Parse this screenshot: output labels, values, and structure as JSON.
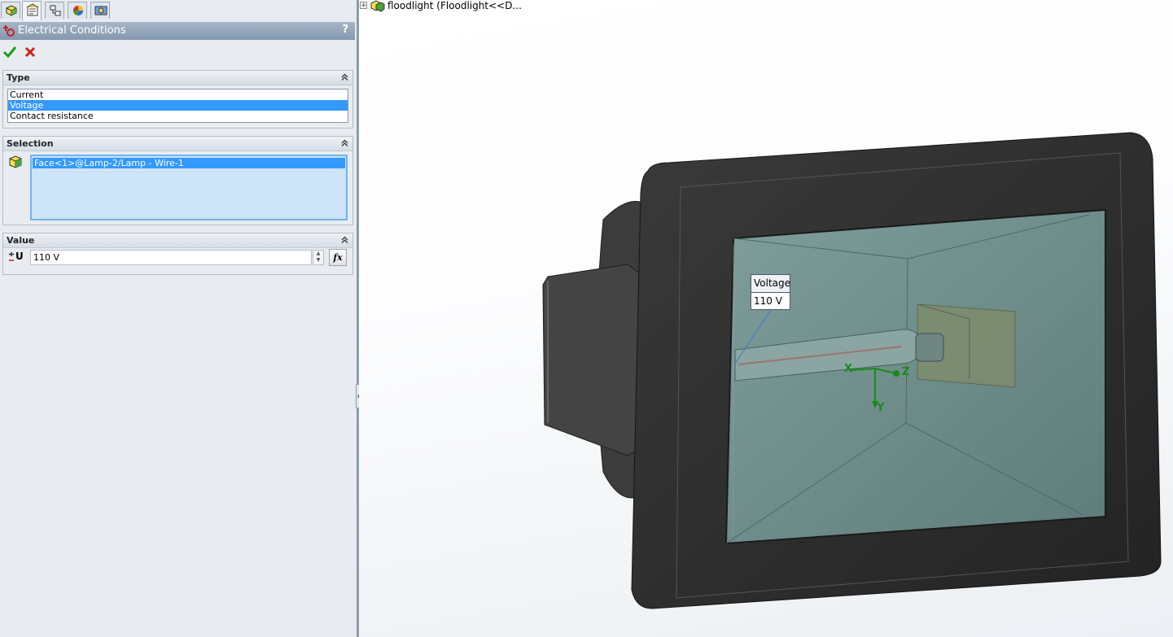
{
  "panel": {
    "tabs": [
      "feature-manager",
      "property-manager",
      "configuration-manager",
      "appearance-manager",
      "display-manager"
    ],
    "title": "Electrical Conditions",
    "help": "?",
    "groups": {
      "type": {
        "header": "Type",
        "options": [
          "Current",
          "Voltage",
          "Contact resistance"
        ],
        "selected": "Voltage"
      },
      "selection": {
        "header": "Selection",
        "items": [
          "Face<1>@Lamp-2/Lamp - Wire-1"
        ]
      },
      "value": {
        "header": "Value",
        "icon_label": "U",
        "input_value": "110 V",
        "fx_label": "fx"
      }
    }
  },
  "viewport": {
    "tree_label": "floodlight  (Floodlight<<D...",
    "callout": {
      "header": "Voltage",
      "value": "110 V"
    },
    "triad": {
      "x": "X",
      "y": "Y",
      "z": "Z"
    }
  },
  "colors": {
    "selection_blue": "#3399ff",
    "title_bar": "#8397ae",
    "panel_bg": "#e8ecf0",
    "triad_green": "#1a8a1a"
  }
}
